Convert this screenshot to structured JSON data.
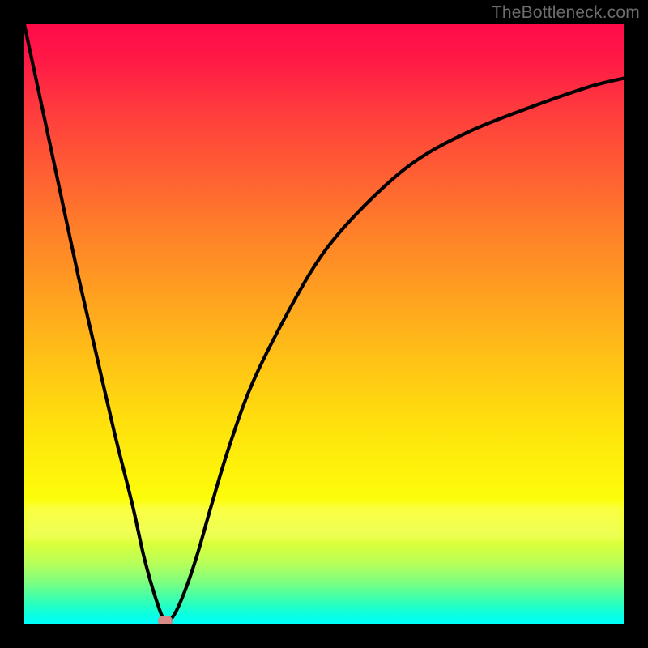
{
  "watermark": "TheBottleneck.com",
  "chart_data": {
    "type": "line",
    "title": "",
    "xlabel": "",
    "ylabel": "",
    "xlim": [
      0,
      100
    ],
    "ylim": [
      0,
      100
    ],
    "grid": false,
    "legend": false,
    "background": "vertical red-orange-yellow-green gradient (red at top, green at bottom)",
    "series": [
      {
        "name": "bottleneck-curve",
        "color": "#000000",
        "x": [
          0,
          3,
          6,
          9,
          12,
          15,
          18,
          20,
          22,
          23.5,
          25,
          27,
          29,
          31,
          34,
          38,
          44,
          50,
          57,
          65,
          74,
          84,
          94,
          100
        ],
        "y": [
          100,
          86,
          72,
          58,
          45,
          32,
          20,
          11,
          4,
          0.5,
          1.5,
          6,
          12,
          19,
          29,
          40,
          52,
          62,
          70,
          77,
          82,
          86,
          89.5,
          91
        ]
      }
    ],
    "annotations": [
      {
        "type": "marker",
        "shape": "pill",
        "color": "#d88a88",
        "x": 23.5,
        "y": 0.5,
        "note": "optimal point marker at curve minimum"
      }
    ]
  }
}
